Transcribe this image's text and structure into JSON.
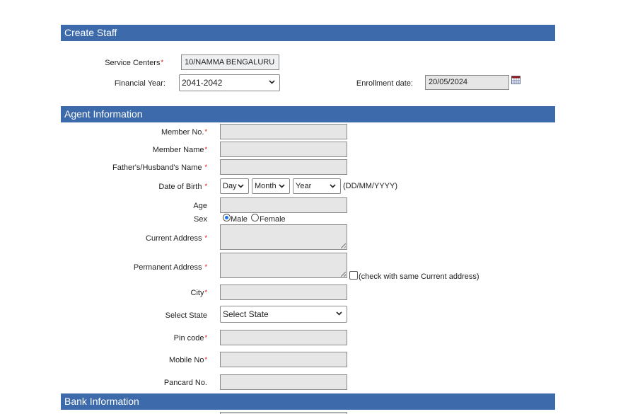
{
  "create_staff": {
    "title": "Create Staff",
    "service_centers_label": "Service Centers",
    "service_centers_value": "10/NAMMA BENGALURU",
    "financial_year_label": "Financial Year:",
    "financial_year_value": "2041-2042",
    "enrollment_label": "Enrollment date:",
    "enrollment_value": "20/05/2024",
    "required_mark": "*"
  },
  "agent": {
    "title": "Agent Information",
    "member_no_label": "Member No.",
    "member_name_label": "Member Name",
    "father_label": "Father's/Husband's Name",
    "dob_label": "Date of Birth",
    "dob_day": "Day",
    "dob_month": "Month",
    "dob_year": "Year",
    "dob_hint": "(DD/MM/YYYY)",
    "age_label": "Age",
    "sex_label": "Sex",
    "male_label": "Male",
    "female_label": "Female",
    "sex_selected": "Male",
    "current_address_label": "Current Address",
    "permanent_address_label": "Permanent Address",
    "same_address_label": "(check with same Current address)",
    "city_label": "City",
    "state_label": "Select State",
    "state_value": "Select State",
    "pin_label": "Pin code",
    "mobile_label": "Mobile No",
    "pancard_label": "Pancard No."
  },
  "bank": {
    "title": "Bank Information"
  },
  "icons": [
    "calendar-icon",
    "chevron-down-icon"
  ],
  "colors": {
    "section_header": "#3c6aaa",
    "required": "#dd0000",
    "readonly_field": "#e6e6e6"
  }
}
